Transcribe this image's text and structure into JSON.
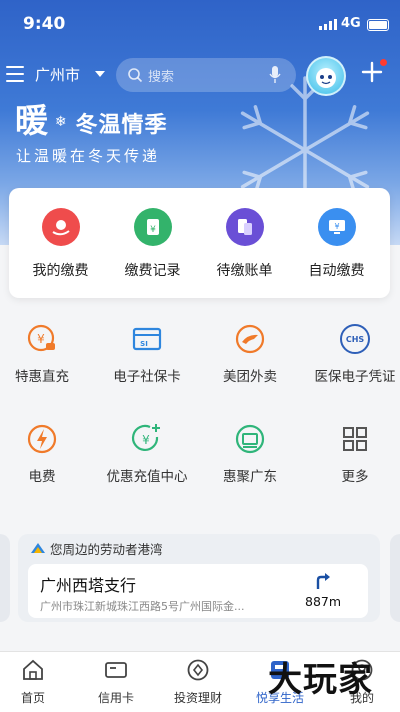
{
  "status": {
    "time": "9:40",
    "network": "4G"
  },
  "header": {
    "city": "广州市",
    "search_placeholder": "搜索"
  },
  "banner": {
    "title_main": "暖",
    "title_rest": "冬温情季",
    "subtitle": "让温暖在冬天传递"
  },
  "quick_actions": [
    {
      "label": "我的缴费",
      "icon": "hand-yuan-icon",
      "color": "#ef4c4c"
    },
    {
      "label": "缴费记录",
      "icon": "clipboard-yuan-icon",
      "color": "#33b36b"
    },
    {
      "label": "待缴账单",
      "icon": "bills-icon",
      "color": "#6a4fd6"
    },
    {
      "label": "自动缴费",
      "icon": "monitor-yuan-icon",
      "color": "#3a8ff0"
    }
  ],
  "services": [
    {
      "label": "特惠直充",
      "icon": "yuan-tag-icon"
    },
    {
      "label": "电子社保卡",
      "icon": "social-security-card-icon"
    },
    {
      "label": "美团外卖",
      "icon": "meituan-kangaroo-icon"
    },
    {
      "label": "医保电子凭证",
      "icon": "chs-icon"
    },
    {
      "label": "电费",
      "icon": "lightning-icon"
    },
    {
      "label": "优惠充值中心",
      "icon": "yuan-plus-icon"
    },
    {
      "label": "惠聚广东",
      "icon": "shop-icon"
    },
    {
      "label": "更多",
      "icon": "grid-more-icon"
    }
  ],
  "nearby": {
    "header": "您周边的劳动者港湾",
    "branch_name": "广州西塔支行",
    "address": "广州市珠江新城珠江西路5号广州国际金...",
    "distance": "887m"
  },
  "tabs": [
    {
      "label": "首页",
      "icon": "home-icon"
    },
    {
      "label": "信用卡",
      "icon": "credit-card-icon"
    },
    {
      "label": "投资理财",
      "icon": "invest-icon"
    },
    {
      "label": "悦享生活",
      "icon": "life-icon",
      "active": true
    },
    {
      "label": "我的",
      "icon": "user-icon"
    }
  ],
  "watermark": "大玩家",
  "colors": {
    "primary": "#2e63c9",
    "service_orange": "#f07a2a",
    "service_blue": "#2e86de",
    "service_green": "#2fb57a"
  }
}
